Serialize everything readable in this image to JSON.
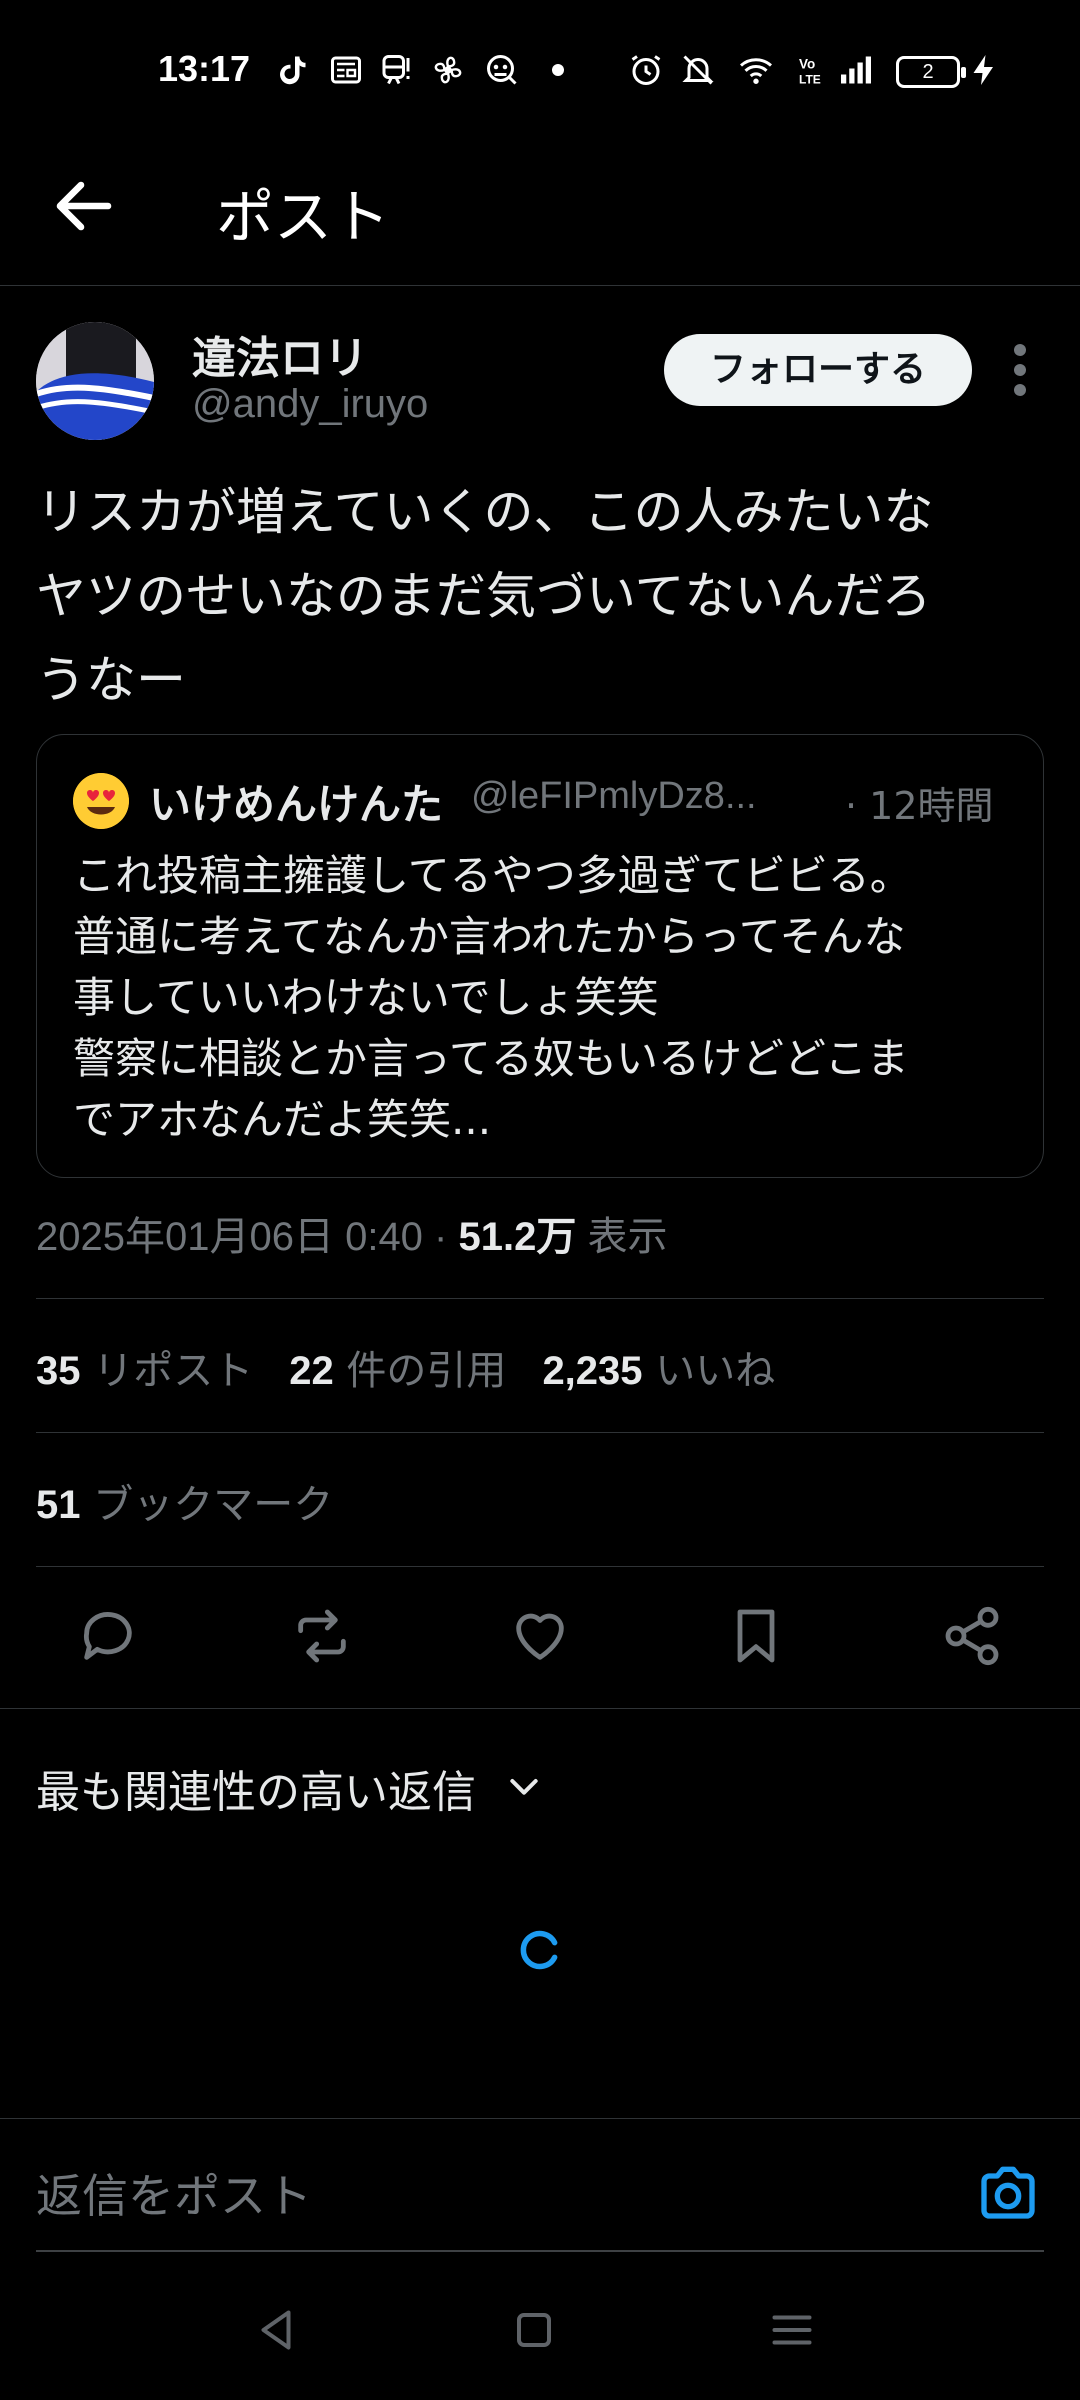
{
  "status_bar": {
    "time": "13:17",
    "battery_level": "2",
    "icons": [
      "tiktok-icon",
      "news-icon",
      "train-icon",
      "fan-icon",
      "robot-icon",
      "dot-icon",
      "alarm-icon",
      "mute-icon",
      "wifi-icon",
      "volte-icon",
      "signal-icon",
      "battery-icon",
      "charging-icon"
    ]
  },
  "header": {
    "title": "ポスト"
  },
  "post": {
    "author_name": "違法ロリ",
    "author_handle": "@andy_iruyo",
    "follow_label": "フォローする",
    "text": "リスカが増えていくの、この人みたいな\nヤツのせいなのまだ気づいてないんだろ\nうなー",
    "timestamp": "2025年01月06日 0:40 · ",
    "views_count": "51.2万",
    "views_label": " 表示"
  },
  "quote": {
    "name": "いけめんけんた",
    "handle": "@leFIPmlyDz8...",
    "time": "· 12時間",
    "text": "これ投稿主擁護してるやつ多過ぎてビビる。\n普通に考えてなんか言われたからってそんな\n事していいわけないでしょ笑笑\n警察に相談とか言ってる奴もいるけどどこま\nでアホなんだよ笑笑..."
  },
  "stats": {
    "reposts_count": "35",
    "reposts_label": " リポスト",
    "quotes_count": "22",
    "quotes_label": " 件の引用",
    "likes_count": "2,235",
    "likes_label": " いいね",
    "bookmarks_count": "51",
    "bookmarks_label": " ブックマーク"
  },
  "replies": {
    "sort_label": "最も関連性の高い返信"
  },
  "reply_bar": {
    "placeholder": "返信をポスト"
  },
  "colors": {
    "background": "#000000",
    "text": "#e7e9ea",
    "secondary": "#71767b",
    "accent": "#1d9bf0",
    "divider": "#2f3336"
  }
}
